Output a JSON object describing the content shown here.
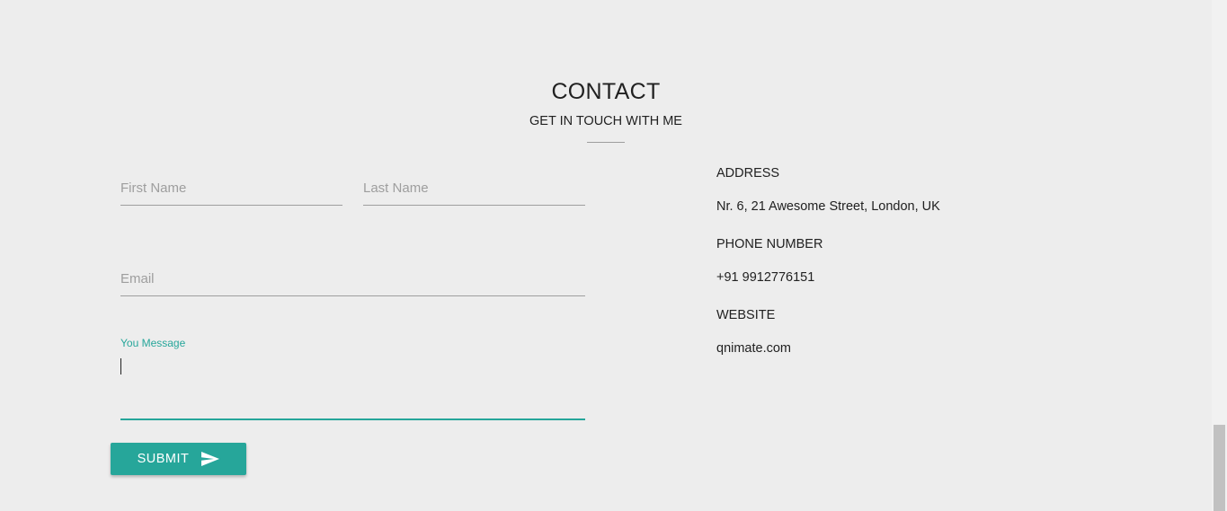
{
  "section": {
    "title": "CONTACT",
    "subtitle": "GET IN TOUCH WITH ME"
  },
  "form": {
    "first_name": {
      "placeholder": "First Name",
      "value": ""
    },
    "last_name": {
      "placeholder": "Last Name",
      "value": ""
    },
    "email": {
      "placeholder": "Email",
      "value": ""
    },
    "message": {
      "label": "You Message",
      "value": ""
    },
    "submit_label": "SUBMIT",
    "submit_icon": "send-icon"
  },
  "contact_info": {
    "address_heading": "ADDRESS",
    "address_value": "Nr. 6, 21 Awesome Street, London, UK",
    "phone_heading": "PHONE NUMBER",
    "phone_value": "+91 9912776151",
    "website_heading": "WEBSITE",
    "website_value": "qnimate.com"
  },
  "colors": {
    "background": "#ededed",
    "accent": "#26a69a",
    "text": "#212121",
    "placeholder": "#9e9e9e"
  }
}
